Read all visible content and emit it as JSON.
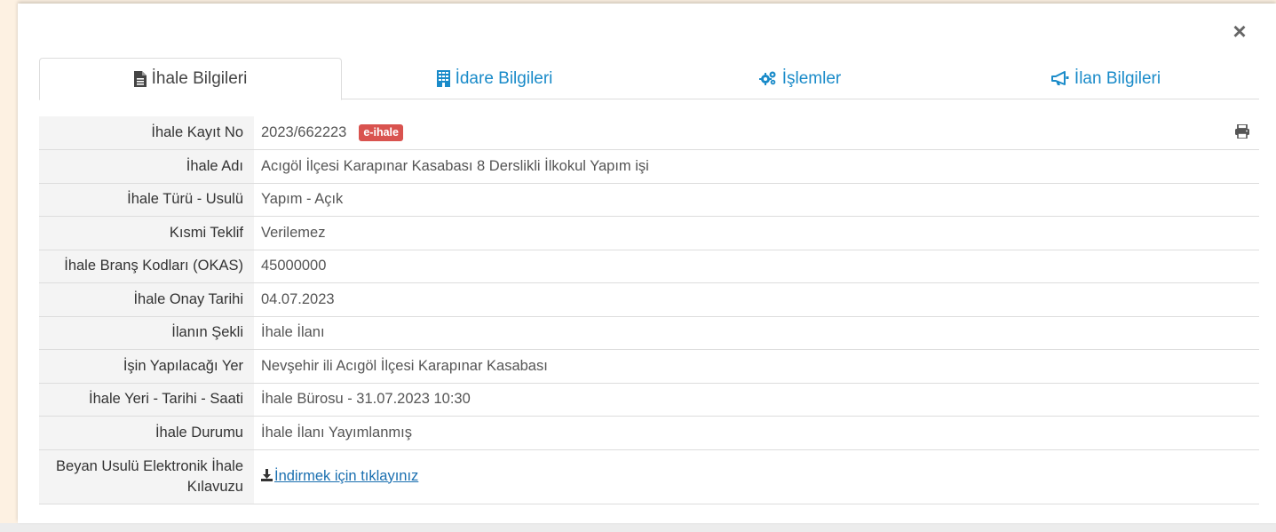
{
  "modal": {
    "close_label": "×"
  },
  "tabs": [
    {
      "label": "İhale Bilgileri",
      "icon": "file-icon",
      "active": true
    },
    {
      "label": "İdare Bilgileri",
      "icon": "building-icon",
      "active": false
    },
    {
      "label": "İşlemler",
      "icon": "gears-icon",
      "active": false
    },
    {
      "label": "İlan Bilgileri",
      "icon": "bullhorn-icon",
      "active": false
    }
  ],
  "details": {
    "kayit_no": {
      "label": "İhale Kayıt No",
      "value": "2023/662223",
      "badge": "e-ihale"
    },
    "adi": {
      "label": "İhale Adı",
      "value": "Acıgöl İlçesi Karapınar Kasabası 8 Derslikli İlkokul Yapım işi"
    },
    "turu": {
      "label": "İhale Türü - Usulü",
      "value": "Yapım - Açık"
    },
    "kismi": {
      "label": "Kısmi Teklif",
      "value": "Verilemez"
    },
    "okas": {
      "label": "İhale Branş Kodları (OKAS)",
      "value": "45000000"
    },
    "onay": {
      "label": "İhale Onay Tarihi",
      "value": "04.07.2023"
    },
    "ilan_sekli": {
      "label": "İlanın Şekli",
      "value": "İhale İlanı"
    },
    "yer": {
      "label": "İşin Yapılacağı Yer",
      "value": "Nevşehir ili Acıgöl İlçesi Karapınar Kasabası"
    },
    "yer_tarih": {
      "label": "İhale Yeri - Tarihi - Saati",
      "value": "İhale Bürosu - 31.07.2023 10:30"
    },
    "durum": {
      "label": "İhale Durumu",
      "value": "İhale İlanı Yayımlanmış"
    },
    "kilavuz": {
      "label_line1": "Beyan Usulü Elektronik İhale",
      "label_line2": "Kılavuzu",
      "link": "İndirmek için tıklayınız"
    }
  },
  "colors": {
    "accent": "#1a8bc9",
    "badge": "#d9534f",
    "side_background": "#fdf1e2"
  }
}
